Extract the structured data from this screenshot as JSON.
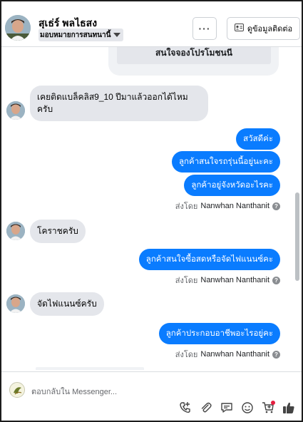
{
  "header": {
    "name": "สุเธ่ร์ พลไธสง",
    "assign_label": "มอบหมายการสนทนานี้",
    "more_label": "···",
    "contact_label": "ดูข้อมูลติดต่อ"
  },
  "chat": {
    "quoted_text": "สนใจจองโปรโมชนนี",
    "messages": [
      {
        "side": "in",
        "text": "เคยติดแบล็คลิส9_10 ปีมาแล้วออกได้ไหมครับ"
      },
      {
        "side": "out",
        "text": "สวัสดีค่ะ"
      },
      {
        "side": "out",
        "text": "ลูกค้าสนใจรถรุ่นนี้อยู่นะคะ"
      },
      {
        "side": "out",
        "text": "ลูกค้าอยู่จังหวัดอะไรคะ"
      },
      {
        "side": "in",
        "text": "โคราชครับ"
      },
      {
        "side": "out",
        "text": "ลูกค้าสนใจซื้อสดหรือจัดไฟแนนซ์คะ"
      },
      {
        "side": "in",
        "text": "จัดไฟแนนซ์ครับ"
      },
      {
        "side": "out",
        "text": "ลูกค้าประกอบอาชีพอะไรอยู่คะ"
      }
    ],
    "sent_by_prefix": "ส่งโดย",
    "sent_by_name": "Nanwhan Nanthanit"
  },
  "composer": {
    "placeholder": "ตอบกลับใน Messenger..."
  },
  "colors": {
    "accent": "#0a7cff",
    "incoming_bubble": "#e4e6eb",
    "notification_dot": "#e41e3f"
  },
  "icons": [
    "more-icon",
    "contact-card-icon",
    "chevron-down-icon",
    "help-icon",
    "add-call-icon",
    "attachment-icon",
    "saved-reply-icon",
    "emoji-icon",
    "cart-icon",
    "like-icon"
  ]
}
